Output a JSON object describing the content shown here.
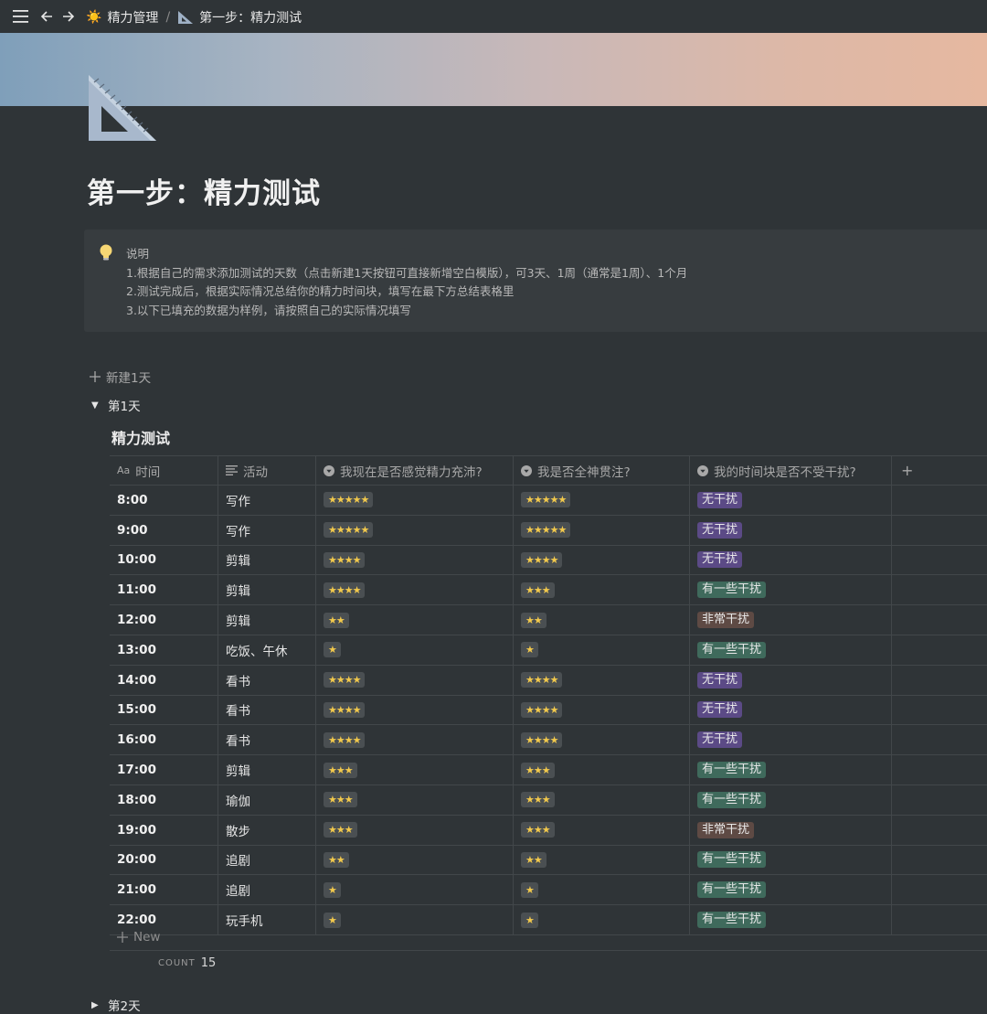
{
  "breadcrumb": {
    "parent_emoji": "☀️",
    "parent": "精力管理",
    "separator": "/",
    "current": "第一步：精力测试"
  },
  "page": {
    "title": "第一步：精力测试"
  },
  "callout": {
    "heading": "说明",
    "lines": [
      "1.根据自己的需求添加测试的天数（点击新建1天按钮可直接新增空白模版），可3天、1周（通常是1周）、1个月",
      "2.测试完成后，根据实际情况总结你的精力时间块，填写在最下方总结表格里",
      "3.以下已填充的数据为样例，请按照自己的实际情况填写"
    ]
  },
  "new_day_label": "新建1天",
  "day1_label": "第1天",
  "day2_label": "第2天",
  "database": {
    "title": "精力测试",
    "columns": [
      "时间",
      "活动",
      "我现在是否感觉精力充沛?",
      "我是否全神贯注?",
      "我的时间块是否不受干扰?"
    ],
    "add_column": "+",
    "rows": [
      {
        "time": "8:00",
        "activity": "写作",
        "energy": 5,
        "focus": 5,
        "interrupt": "无干扰"
      },
      {
        "time": "9:00",
        "activity": "写作",
        "energy": 5,
        "focus": 5,
        "interrupt": "无干扰"
      },
      {
        "time": "10:00",
        "activity": "剪辑",
        "energy": 4,
        "focus": 4,
        "interrupt": "无干扰"
      },
      {
        "time": "11:00",
        "activity": "剪辑",
        "energy": 4,
        "focus": 3,
        "interrupt": "有一些干扰"
      },
      {
        "time": "12:00",
        "activity": "剪辑",
        "energy": 2,
        "focus": 2,
        "interrupt": "非常干扰"
      },
      {
        "time": "13:00",
        "activity": "吃饭、午休",
        "energy": 1,
        "focus": 1,
        "interrupt": "有一些干扰"
      },
      {
        "time": "14:00",
        "activity": "看书",
        "energy": 4,
        "focus": 4,
        "interrupt": "无干扰"
      },
      {
        "time": "15:00",
        "activity": "看书",
        "energy": 4,
        "focus": 4,
        "interrupt": "无干扰"
      },
      {
        "time": "16:00",
        "activity": "看书",
        "energy": 4,
        "focus": 4,
        "interrupt": "无干扰"
      },
      {
        "time": "17:00",
        "activity": "剪辑",
        "energy": 3,
        "focus": 3,
        "interrupt": "有一些干扰"
      },
      {
        "time": "18:00",
        "activity": "瑜伽",
        "energy": 3,
        "focus": 3,
        "interrupt": "有一些干扰"
      },
      {
        "time": "19:00",
        "activity": "散步",
        "energy": 3,
        "focus": 3,
        "interrupt": "非常干扰"
      },
      {
        "time": "20:00",
        "activity": "追剧",
        "energy": 2,
        "focus": 2,
        "interrupt": "有一些干扰"
      },
      {
        "time": "21:00",
        "activity": "追剧",
        "energy": 1,
        "focus": 1,
        "interrupt": "有一些干扰"
      },
      {
        "time": "22:00",
        "activity": "玩手机",
        "energy": 1,
        "focus": 1,
        "interrupt": "有一些干扰"
      }
    ],
    "new_row_label": "New",
    "count_label": "COUNT",
    "count_value": "15"
  },
  "tag_colors": {
    "无干扰": "#5b4a86",
    "有一些干扰": "#3f6a5c",
    "非常干扰": "#5e4a44"
  }
}
